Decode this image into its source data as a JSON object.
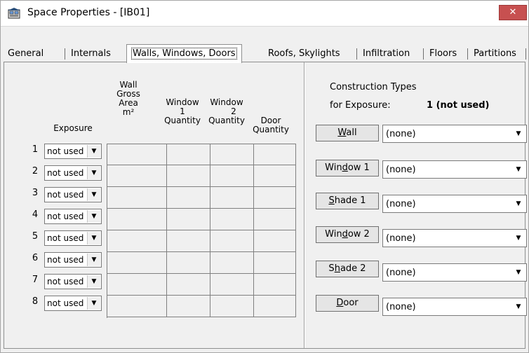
{
  "window": {
    "title": "Space Properties - [IB01]",
    "close_label": "✕"
  },
  "tabs": [
    "General",
    "Internals",
    "Walls, Windows, Doors",
    "Roofs, Skylights",
    "Infiltration",
    "Floors",
    "Partitions"
  ],
  "active_tab": "Walls, Windows, Doors",
  "table": {
    "headers": {
      "exposure": "Exposure",
      "wall_area": [
        "Wall",
        "Gross",
        "Area",
        "m²"
      ],
      "window1": [
        "Window",
        "1",
        "Quantity"
      ],
      "window2": [
        "Window",
        "2",
        "Quantity"
      ],
      "door": [
        "Door",
        "Quantity"
      ]
    },
    "rows": [
      {
        "num": "1",
        "exposure": "not used"
      },
      {
        "num": "2",
        "exposure": "not used"
      },
      {
        "num": "3",
        "exposure": "not used"
      },
      {
        "num": "4",
        "exposure": "not used"
      },
      {
        "num": "5",
        "exposure": "not used"
      },
      {
        "num": "6",
        "exposure": "not used"
      },
      {
        "num": "7",
        "exposure": "not used"
      },
      {
        "num": "8",
        "exposure": "not used"
      }
    ]
  },
  "construction": {
    "heading_line1": "Construction Types",
    "heading_line2": "for Exposure:",
    "exposure_value": "1 (not used)",
    "types": [
      {
        "label": "Wall",
        "mnemonic": "W",
        "rest": "all",
        "value": "(none)"
      },
      {
        "label": "Window 1",
        "mnemonic": "d",
        "pre": "Win",
        "rest": "ow 1",
        "value": "(none)"
      },
      {
        "label": "Shade 1",
        "mnemonic": "S",
        "rest": "hade 1",
        "value": "(none)"
      },
      {
        "label": "Window 2",
        "mnemonic": "d",
        "pre": "Win",
        "rest": "ow 2",
        "value": "(none)"
      },
      {
        "label": "Shade 2",
        "mnemonic": "h",
        "pre": "S",
        "rest": "ade 2",
        "value": "(none)"
      },
      {
        "label": "Door",
        "mnemonic": "D",
        "rest": "oor",
        "value": "(none)"
      }
    ]
  }
}
